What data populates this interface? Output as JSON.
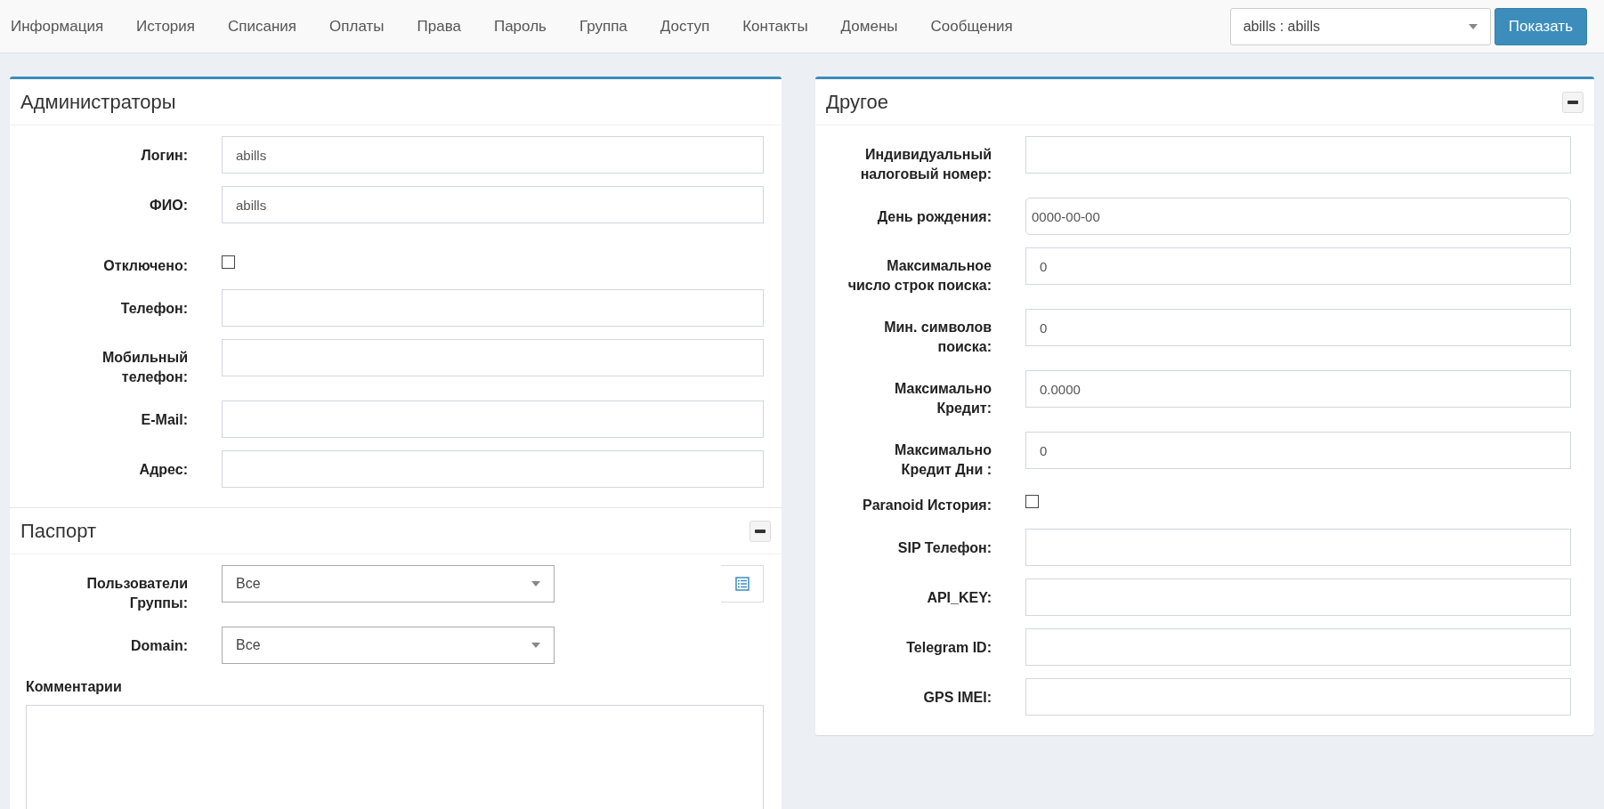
{
  "nav": {
    "tabs": [
      "Информация",
      "История",
      "Списания",
      "Оплаты",
      "Права",
      "Пароль",
      "Группа",
      "Доступ",
      "Контакты",
      "Домены",
      "Сообщения"
    ],
    "user_select": {
      "value": "abills : abills"
    },
    "show_button": "Показать"
  },
  "left_panel": {
    "sections": [
      {
        "title": "Администраторы",
        "collapsible": false,
        "fields": [
          {
            "label": "Логин:",
            "kind": "text",
            "value": "abills"
          },
          {
            "label": "ФИО:",
            "kind": "text",
            "value": "abills"
          },
          {
            "label": "Отключено:",
            "kind": "checkbox",
            "checked": false
          },
          {
            "label": "Телефон:",
            "kind": "text"
          },
          {
            "label": "Мобильный телефон:",
            "kind": "text"
          },
          {
            "label": "E-Mail:",
            "kind": "text"
          },
          {
            "label": "Адрес:",
            "kind": "text"
          }
        ]
      },
      {
        "title": "Паспорт",
        "collapsible": true,
        "fields": [
          {
            "label": "Пользователи Группы:",
            "kind": "select",
            "value": "Все",
            "list_button": true
          },
          {
            "label": "Domain:",
            "kind": "select",
            "value": "Все",
            "list_button": false
          }
        ],
        "comments_label": "Комментарии"
      }
    ]
  },
  "right_panel": {
    "title": "Другое",
    "collapsible": true,
    "fields": [
      {
        "label": "Индивидуальный налоговый номер:",
        "kind": "text"
      },
      {
        "label": "День рождения:",
        "kind": "date",
        "value": "0000-00-00"
      },
      {
        "label": "Максимальное число строк поиска:",
        "kind": "text",
        "value": "0"
      },
      {
        "label": "Мин. символов поиска:",
        "kind": "text",
        "value": "0"
      },
      {
        "label": "Максимально Кредит:",
        "kind": "text",
        "value": "0.0000"
      },
      {
        "label": "Максимально Кредит Дни :",
        "kind": "text",
        "value": "0"
      },
      {
        "label": "Paranoid История:",
        "kind": "checkbox",
        "checked": false
      },
      {
        "label": "SIP Телефон:",
        "kind": "text"
      },
      {
        "label": "API_KEY:",
        "kind": "text"
      },
      {
        "label": "Telegram ID:",
        "kind": "text"
      },
      {
        "label": "GPS IMEI:",
        "kind": "text"
      }
    ]
  }
}
